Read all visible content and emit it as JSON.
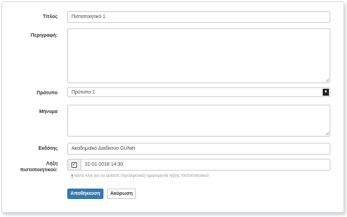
{
  "form": {
    "title": {
      "label": "Τίτλος",
      "value": "Πιστοποιητικό 1"
    },
    "description": {
      "label": "Περιγραφή:",
      "value": ""
    },
    "template": {
      "label": "Πρότυπο",
      "selected": "Πρότυπο 1"
    },
    "message": {
      "label": "Μήνυμα",
      "value": ""
    },
    "issuer": {
      "label": "Εκδότης",
      "value": "Ακαδημαϊκό Διαδίκτυο GUNet"
    },
    "expiry": {
      "label_line1": "Λήξη",
      "label_line2": "πιστοποιητικού:",
      "checked": true,
      "check_glyph": "✓",
      "value": "31-01-2018 14:30",
      "hint": "κάντε κλικ για να ορίσετε (προαιρετικά) ημερομηνία λήξης πιστοποιητικού",
      "hint_icon": "arrow-up-icon"
    }
  },
  "buttons": {
    "submit_label": "Αποθήκευση",
    "cancel_label": "Ακύρωση"
  },
  "colors": {
    "primary": "#337ab7",
    "border": "#cccccc",
    "hint": "#999999"
  }
}
